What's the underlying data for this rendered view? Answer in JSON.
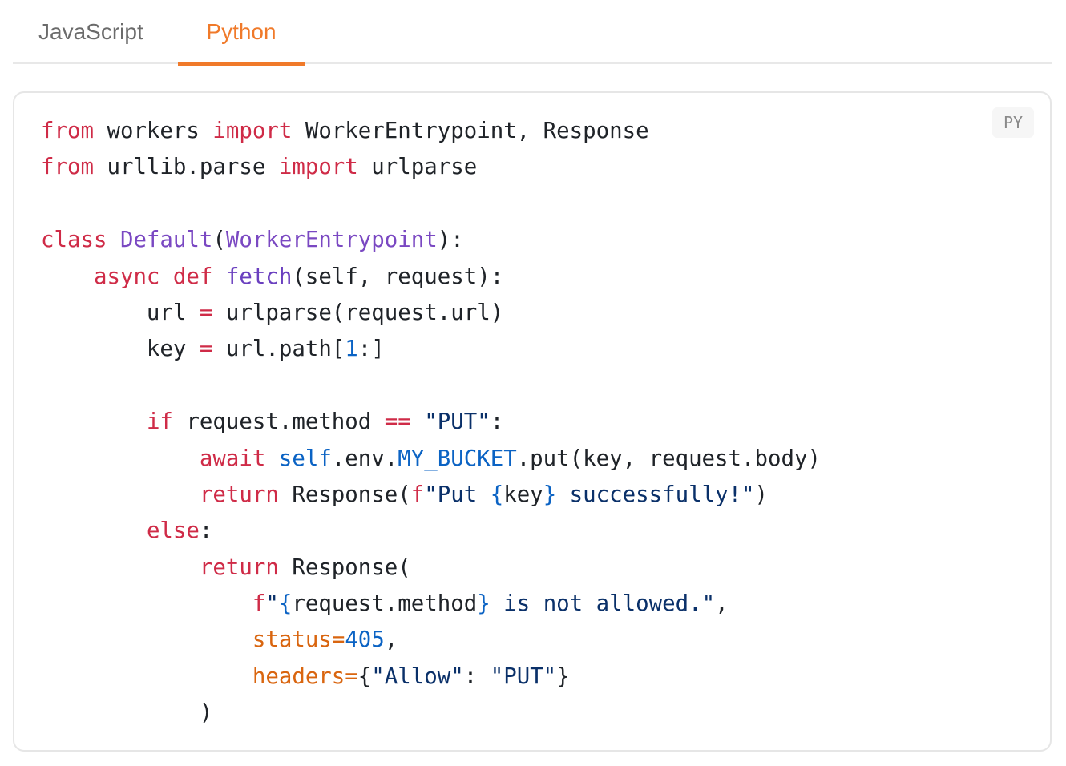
{
  "tabs": {
    "items": [
      {
        "label": "JavaScript",
        "active": false
      },
      {
        "label": "Python",
        "active": true
      }
    ],
    "active_color": "#f07a2a"
  },
  "code_block": {
    "language_badge": "PY",
    "lines": [
      [
        {
          "t": "from",
          "c": "kw"
        },
        {
          "t": " workers "
        },
        {
          "t": "import",
          "c": "kw"
        },
        {
          "t": " WorkerEntrypoint, Response"
        }
      ],
      [
        {
          "t": "from",
          "c": "kw"
        },
        {
          "t": " urllib.parse "
        },
        {
          "t": "import",
          "c": "kw"
        },
        {
          "t": " urlparse"
        }
      ],
      [],
      [
        {
          "t": "class",
          "c": "kw"
        },
        {
          "t": " "
        },
        {
          "t": "Default",
          "c": "cls"
        },
        {
          "t": "("
        },
        {
          "t": "WorkerEntrypoint",
          "c": "cls"
        },
        {
          "t": "):"
        }
      ],
      [
        {
          "t": "    "
        },
        {
          "t": "async",
          "c": "kw"
        },
        {
          "t": " "
        },
        {
          "t": "def",
          "c": "kw"
        },
        {
          "t": " "
        },
        {
          "t": "fetch",
          "c": "fn"
        },
        {
          "t": "(self, request):"
        }
      ],
      [
        {
          "t": "        url "
        },
        {
          "t": "=",
          "c": "op"
        },
        {
          "t": " urlparse(request.url)"
        }
      ],
      [
        {
          "t": "        key "
        },
        {
          "t": "=",
          "c": "op"
        },
        {
          "t": " url.path["
        },
        {
          "t": "1",
          "c": "num"
        },
        {
          "t": ":]"
        }
      ],
      [],
      [
        {
          "t": "        "
        },
        {
          "t": "if",
          "c": "kw"
        },
        {
          "t": " request.method "
        },
        {
          "t": "==",
          "c": "op"
        },
        {
          "t": " "
        },
        {
          "t": "\"PUT\"",
          "c": "str"
        },
        {
          "t": ":"
        }
      ],
      [
        {
          "t": "            "
        },
        {
          "t": "await",
          "c": "kw"
        },
        {
          "t": " "
        },
        {
          "t": "self",
          "c": "bi"
        },
        {
          "t": ".env."
        },
        {
          "t": "MY_BUCKET",
          "c": "bi"
        },
        {
          "t": ".put(key, request.body)"
        }
      ],
      [
        {
          "t": "            "
        },
        {
          "t": "return",
          "c": "kw"
        },
        {
          "t": " Response("
        },
        {
          "t": "f",
          "c": "kw"
        },
        {
          "t": "\"Put ",
          "c": "str"
        },
        {
          "t": "{",
          "c": "bi"
        },
        {
          "t": "key"
        },
        {
          "t": "}",
          "c": "bi"
        },
        {
          "t": " successfully!\"",
          "c": "str"
        },
        {
          "t": ")"
        }
      ],
      [
        {
          "t": "        "
        },
        {
          "t": "else",
          "c": "kw"
        },
        {
          "t": ":"
        }
      ],
      [
        {
          "t": "            "
        },
        {
          "t": "return",
          "c": "kw"
        },
        {
          "t": " Response("
        }
      ],
      [
        {
          "t": "                "
        },
        {
          "t": "f",
          "c": "kw"
        },
        {
          "t": "\"",
          "c": "str"
        },
        {
          "t": "{",
          "c": "bi"
        },
        {
          "t": "request.method"
        },
        {
          "t": "}",
          "c": "bi"
        },
        {
          "t": " is not allowed.\"",
          "c": "str"
        },
        {
          "t": ","
        }
      ],
      [
        {
          "t": "                "
        },
        {
          "t": "status",
          "c": "prm"
        },
        {
          "t": "=",
          "c": "prm"
        },
        {
          "t": "405",
          "c": "num"
        },
        {
          "t": ","
        }
      ],
      [
        {
          "t": "                "
        },
        {
          "t": "headers",
          "c": "prm"
        },
        {
          "t": "=",
          "c": "prm"
        },
        {
          "t": "{"
        },
        {
          "t": "\"Allow\"",
          "c": "str"
        },
        {
          "t": ": "
        },
        {
          "t": "\"PUT\"",
          "c": "str"
        },
        {
          "t": "}"
        }
      ],
      [
        {
          "t": "            )"
        }
      ]
    ]
  }
}
